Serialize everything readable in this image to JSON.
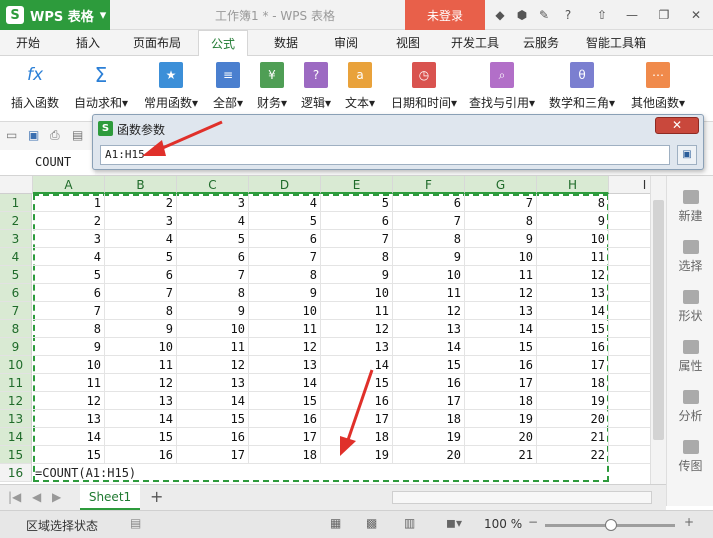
{
  "titlebar": {
    "app_name": "WPS 表格",
    "doc_title": "工作簿1 * - WPS 表格",
    "login_label": "未登录",
    "logo_letter": "S"
  },
  "tabs": [
    "开始",
    "插入",
    "页面布局",
    "公式",
    "数据",
    "审阅",
    "视图",
    "开发工具",
    "云服务",
    "智能工具箱"
  ],
  "active_tab": "公式",
  "ribbon": {
    "buttons": [
      {
        "label": "插入函数",
        "icon": "fx-icon",
        "glyph": "fx"
      },
      {
        "label": "自动求和",
        "icon": "sigma-icon",
        "glyph": "Σ"
      },
      {
        "label": "常用函数",
        "icon": "star-icon",
        "glyph": "★"
      },
      {
        "label": "全部",
        "icon": "list-icon",
        "glyph": "≡"
      },
      {
        "label": "财务",
        "icon": "money-icon",
        "glyph": "¥"
      },
      {
        "label": "逻辑",
        "icon": "question-icon",
        "glyph": "?"
      },
      {
        "label": "文本",
        "icon": "text-icon",
        "glyph": "a"
      },
      {
        "label": "日期和时间",
        "icon": "clock-icon",
        "glyph": "◷"
      },
      {
        "label": "查找与引用",
        "icon": "search-icon",
        "glyph": "⌕"
      },
      {
        "label": "数学和三角",
        "icon": "theta-icon",
        "glyph": "θ"
      },
      {
        "label": "其他函数",
        "icon": "more-icon",
        "glyph": "⋯"
      }
    ]
  },
  "namebox": "COUNT",
  "dialog": {
    "title": "函数参数",
    "input_value": "A1:H15",
    "close_glyph": "✕"
  },
  "columns": [
    "A",
    "B",
    "C",
    "D",
    "E",
    "F",
    "G",
    "H",
    "I"
  ],
  "rows": [
    [
      1,
      2,
      3,
      4,
      5,
      6,
      7,
      8
    ],
    [
      2,
      3,
      4,
      5,
      6,
      7,
      8,
      9
    ],
    [
      3,
      4,
      5,
      6,
      7,
      8,
      9,
      10
    ],
    [
      4,
      5,
      6,
      7,
      8,
      9,
      10,
      11
    ],
    [
      5,
      6,
      7,
      8,
      9,
      10,
      11,
      12
    ],
    [
      6,
      7,
      8,
      9,
      10,
      11,
      12,
      13
    ],
    [
      7,
      8,
      9,
      10,
      11,
      12,
      13,
      14
    ],
    [
      8,
      9,
      10,
      11,
      12,
      13,
      14,
      15
    ],
    [
      9,
      10,
      11,
      12,
      13,
      14,
      15,
      16
    ],
    [
      10,
      11,
      12,
      13,
      14,
      15,
      16,
      17
    ],
    [
      11,
      12,
      13,
      14,
      15,
      16,
      17,
      18
    ],
    [
      12,
      13,
      14,
      15,
      16,
      17,
      18,
      19
    ],
    [
      13,
      14,
      15,
      16,
      17,
      18,
      19,
      20
    ],
    [
      14,
      15,
      16,
      17,
      18,
      19,
      20,
      21
    ],
    [
      15,
      16,
      17,
      18,
      19,
      20,
      21,
      22
    ]
  ],
  "formula_row_number": "16",
  "formula_cell": "=COUNT(A1:H15)",
  "side_panel": [
    "新建",
    "选择",
    "形状",
    "属性",
    "分析",
    "传图"
  ],
  "sheet_tab": "Sheet1",
  "add_sheet_glyph": "+",
  "status": {
    "text": "区域选择状态",
    "zoom": "100 %"
  },
  "colors": {
    "brand_green": "#2d9b3c",
    "login_red": "#e8604a",
    "arrow_red": "#e0302a"
  }
}
